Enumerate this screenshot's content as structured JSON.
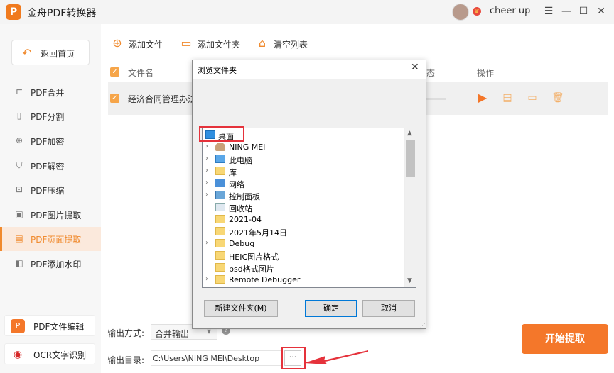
{
  "app": {
    "logo_letter": "P",
    "title": "金舟PDF转换器",
    "username": "cheer up"
  },
  "window_controls": {
    "menu": "☰",
    "minimize": "—",
    "maximize": "☐",
    "close": "✕"
  },
  "sidebar": {
    "home": "返回首页",
    "items": [
      {
        "label": "PDF合并",
        "icon": "merge-icon"
      },
      {
        "label": "PDF分割",
        "icon": "split-icon"
      },
      {
        "label": "PDF加密",
        "icon": "lock-icon"
      },
      {
        "label": "PDF解密",
        "icon": "unlock-icon"
      },
      {
        "label": "PDF压缩",
        "icon": "compress-icon"
      },
      {
        "label": "PDF图片提取",
        "icon": "image-icon"
      },
      {
        "label": "PDF页面提取",
        "icon": "page-icon",
        "active": true
      },
      {
        "label": "PDF添加水印",
        "icon": "watermark-icon"
      }
    ],
    "bottom": [
      {
        "label": "PDF文件编辑",
        "icon_text": "P"
      },
      {
        "label": "OCR文字识别",
        "icon_text": "◉"
      }
    ]
  },
  "toolbar": {
    "add_file": "添加文件",
    "add_folder": "添加文件夹",
    "clear_list": "清空列表"
  },
  "table": {
    "col_filename": "文件名",
    "col_status_partial": "态",
    "col_actions": "操作",
    "rows": [
      {
        "name": "经济合同管理办法"
      }
    ]
  },
  "output": {
    "mode_label": "输出方式:",
    "mode_value": "合并输出",
    "dir_label": "输出目录:",
    "dir_value": "C:\\Users\\NING MEI\\Desktop",
    "browse": "···",
    "start": "开始提取"
  },
  "dialog": {
    "title": "浏览文件夹",
    "tree": [
      {
        "label": "桌面",
        "type": "desktop",
        "selected": true
      },
      {
        "label": "NING MEI",
        "type": "user",
        "expandable": true
      },
      {
        "label": "此电脑",
        "type": "pc",
        "expandable": true
      },
      {
        "label": "库",
        "type": "library",
        "expandable": true
      },
      {
        "label": "网络",
        "type": "network",
        "expandable": true
      },
      {
        "label": "控制面板",
        "type": "control",
        "expandable": true
      },
      {
        "label": "回收站",
        "type": "recycle"
      },
      {
        "label": "2021-04",
        "type": "folder"
      },
      {
        "label": "2021年5月14日",
        "type": "folder"
      },
      {
        "label": "Debug",
        "type": "folder",
        "expandable": true
      },
      {
        "label": "HEIC图片格式",
        "type": "folder"
      },
      {
        "label": "psd格式图片",
        "type": "folder"
      },
      {
        "label": "Remote Debugger",
        "type": "folder",
        "expandable": true
      }
    ],
    "new_folder": "新建文件夹(M)",
    "ok": "确定",
    "cancel": "取消"
  },
  "colors": {
    "accent": "#f08a2e",
    "annotation_red": "#e5323b"
  }
}
